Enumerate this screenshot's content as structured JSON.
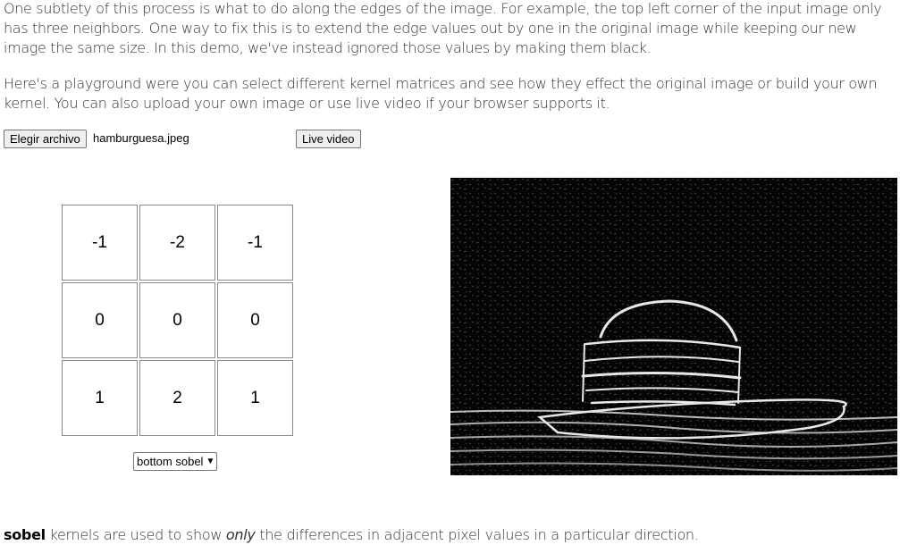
{
  "intro": {
    "p1": "One subtlety of this process is what to do along the edges of the image. For example, the top left corner of the input image only has three neighbors. One way to fix this is to extend the edge values out by one in the original image while keeping our new image the same size. In this demo, we've instead ignored those values by making them black.",
    "p2": "Here's a playground were you can select different kernel matrices and see how they effect the original image or build your own kernel. You can also upload your own image or use live video if your browser supports it."
  },
  "controls": {
    "file_button": "Elegir archivo",
    "file_name": "hamburguesa.jpeg",
    "live_button": "Live video"
  },
  "kernel": {
    "cells": [
      "-1",
      "-2",
      "-1",
      "0",
      "0",
      "0",
      "1",
      "2",
      "1"
    ],
    "selected_preset": "bottom sobel"
  },
  "output": {
    "description_icon": "burger-edge-image"
  },
  "caption": {
    "bold": "sobel",
    "part1": " kernels are used to show ",
    "italic": "only",
    "part2": " the differences in adjacent pixel values in a particular direction."
  },
  "colors": {
    "text": "#333333",
    "image_bg": "#000000"
  }
}
